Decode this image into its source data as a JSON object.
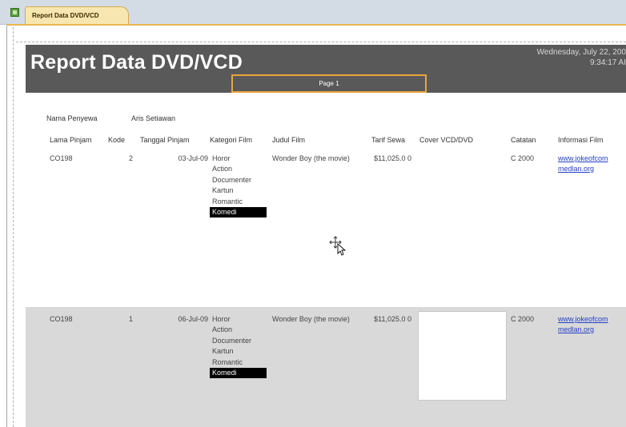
{
  "tab": {
    "title": "Report Data DVD/VCD",
    "icon": "report-icon"
  },
  "header": {
    "title": "Report Data DVD/VCD",
    "date": "Wednesday, July 22, 200",
    "time": "9:34:17 AI",
    "page_label": "Page 1"
  },
  "renter": {
    "label": "Nama Penyewa",
    "value": "Aris  Setiawan"
  },
  "columns": {
    "lama": "Lama Pinjam",
    "kode": "Kode",
    "tanggal": "Tanggal Pinjam",
    "kategori": "Kategori Film",
    "judul": "Judul Film",
    "tarif": "Tarif Sewa",
    "cover": "Cover VCD/DVD",
    "catatan": "Catatan",
    "info": "Informasi Film"
  },
  "records": [
    {
      "lama": "CO198",
      "kode": "2",
      "tanggal": "03-Jul-09",
      "kategori": [
        "Horor",
        "Action",
        "Documenter",
        "Kartun",
        "Romantic",
        "Komedi"
      ],
      "judul": "Wonder Boy (the movie)",
      "tarif": "$11,025.0 0",
      "catatan": "C 2000",
      "info": "www.jokeofcom medlan.org"
    },
    {
      "lama": "CO198",
      "kode": "1",
      "tanggal": "06-Jul-09",
      "kategori": [
        "Horor",
        "Action",
        "Documenter",
        "Kartun",
        "Romantic",
        "Komedi"
      ],
      "judul": "Wonder Boy (the movie)",
      "tarif": "$11,025.0 0",
      "catatan": "C 2000",
      "info": "www.jokeofcom medlan.org"
    }
  ],
  "colors": {
    "header_band": "#595959",
    "accent_orange": "#e8a53a",
    "row_alt": "#d9d9d9",
    "link": "#2340c8"
  },
  "cursor_icon": "move-cursor-icon"
}
